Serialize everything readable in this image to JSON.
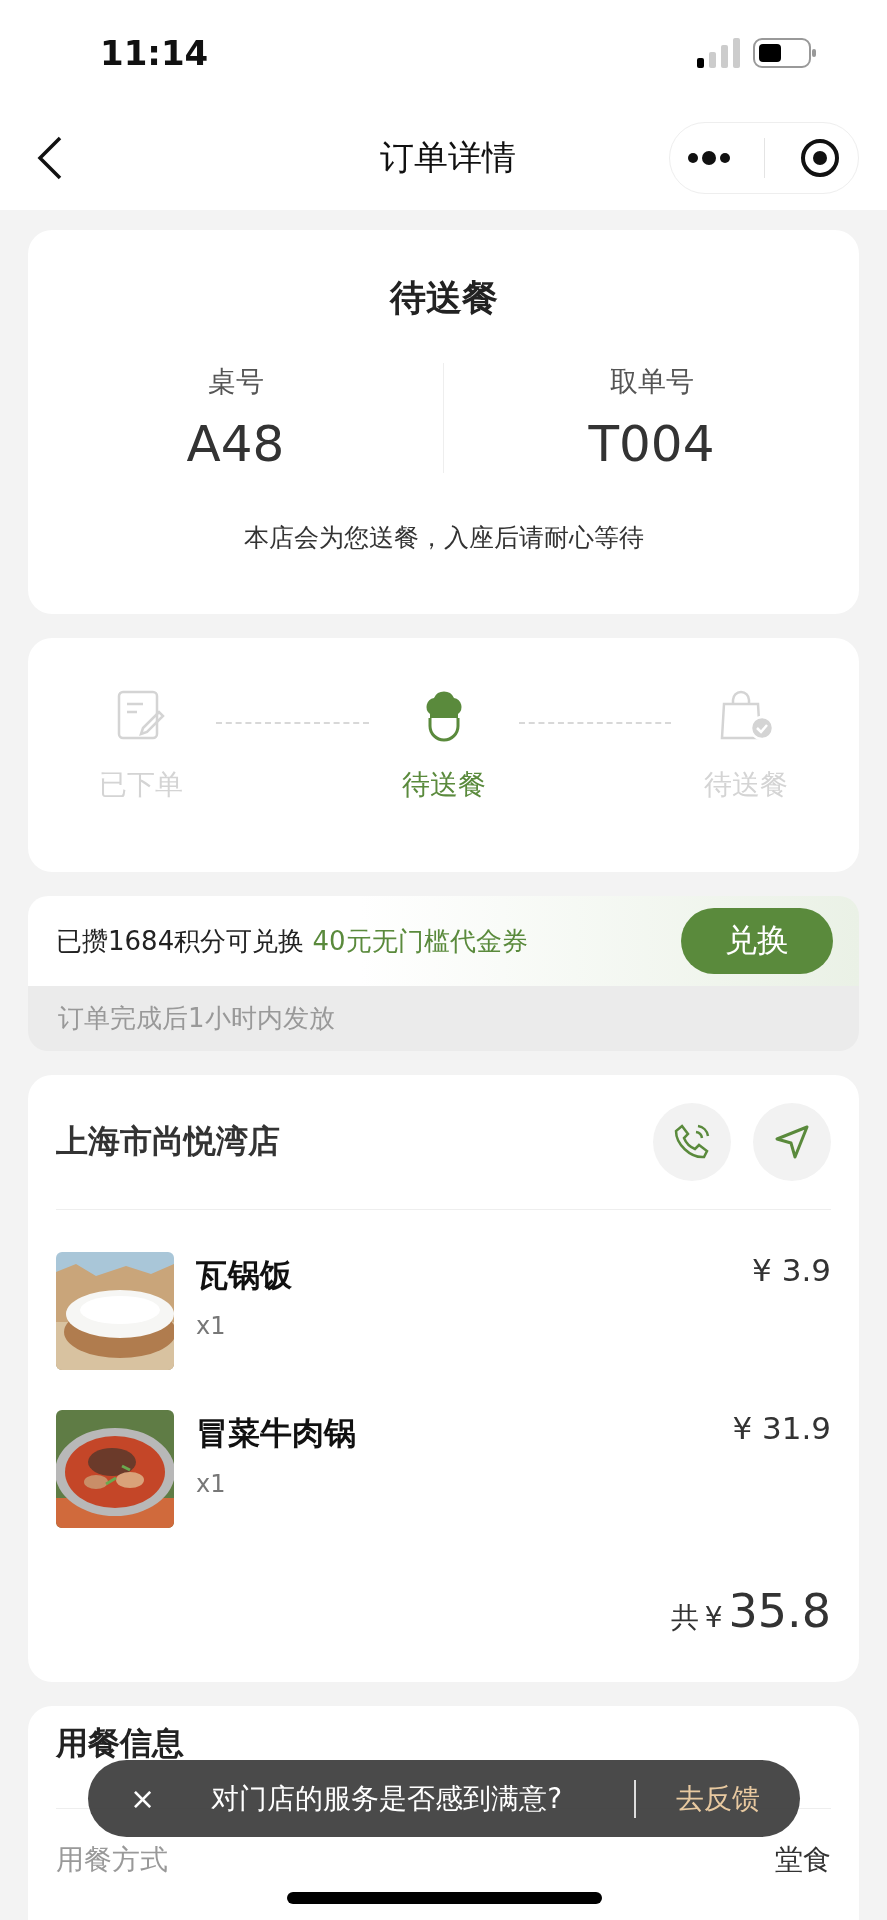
{
  "status_bar": {
    "time": "11:14"
  },
  "nav": {
    "title": "订单详情"
  },
  "order_status": {
    "title": "待送餐",
    "fields": [
      {
        "label": "桌号",
        "value": "A48"
      },
      {
        "label": "取单号",
        "value": "T004"
      }
    ],
    "note": "本店会为您送餐，入座后请耐心等待"
  },
  "steps": [
    {
      "kind": "ordered",
      "label": "已下单",
      "selected": false
    },
    {
      "kind": "cooking",
      "label": "待送餐",
      "selected": true
    },
    {
      "kind": "delivered",
      "label": "待送餐",
      "selected": false
    }
  ],
  "points": {
    "text": "已攒1684积分可兑换",
    "highlight": "40元无门槛代金券",
    "button": "兑换",
    "note": "订单完成后1小时内发放"
  },
  "store": {
    "name": "上海市尚悦湾店",
    "items": [
      {
        "kind": "rice",
        "name": "瓦锅饭",
        "qty": "x1",
        "price": "¥ 3.9"
      },
      {
        "kind": "stew",
        "name": "冒菜牛肉锅",
        "qty": "x1",
        "price": "¥ 31.9"
      }
    ],
    "total_label": "共",
    "total_currency": "¥",
    "total": "35.8"
  },
  "dining": {
    "title": "用餐信息",
    "rows": [
      {
        "label": "用餐方式",
        "value": "堂食"
      }
    ]
  },
  "toast": {
    "close": "×",
    "message": "对门店的服务是否感到满意?",
    "action": "去反馈"
  }
}
